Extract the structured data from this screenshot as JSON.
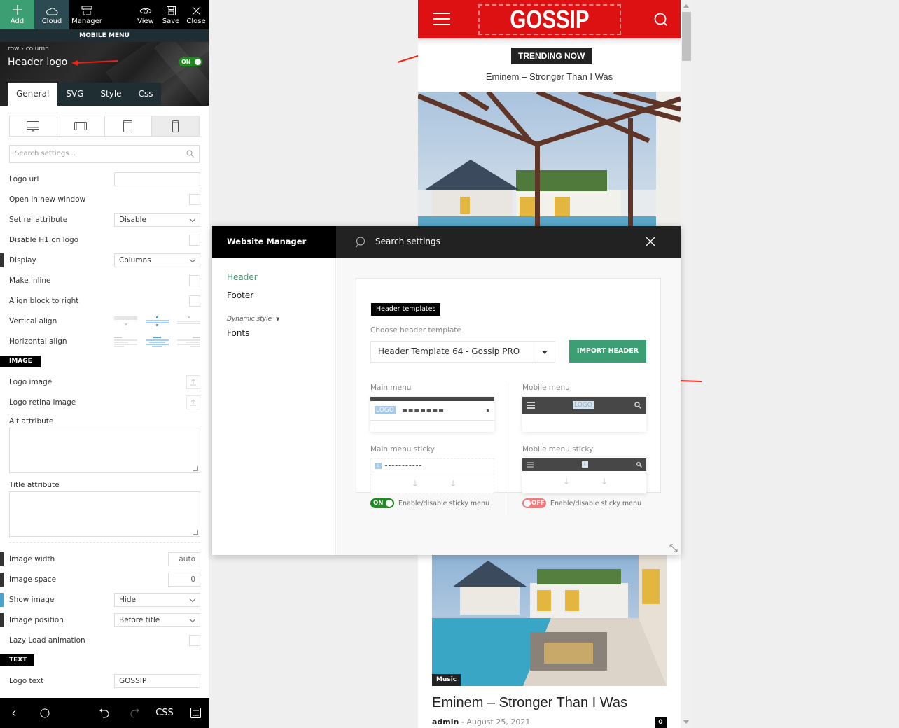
{
  "editor": {
    "toolbar": {
      "add": "Add",
      "cloud": "Cloud",
      "manager": "Manager",
      "view": "View",
      "save": "Save",
      "close": "Close"
    },
    "context_bar": "MOBILE MENU",
    "breadcrumb": [
      "row",
      "column"
    ],
    "element_title": "Header logo",
    "element_toggle": "ON",
    "tabs": [
      "General",
      "SVG",
      "Style",
      "Css"
    ],
    "active_tab": "General",
    "devices": [
      "desktop",
      "tablet-landscape",
      "tablet-portrait",
      "phone"
    ],
    "active_device": "phone",
    "search_placeholder": "Search settings...",
    "settings": {
      "logo_url": {
        "label": "Logo url",
        "value": ""
      },
      "open_new_window": {
        "label": "Open in new window",
        "checked": false
      },
      "rel_attribute": {
        "label": "Set rel attribute",
        "value": "Disable"
      },
      "disable_h1": {
        "label": "Disable H1 on logo",
        "checked": false
      },
      "display": {
        "label": "Display",
        "value": "Columns"
      },
      "make_inline": {
        "label": "Make inline",
        "checked": false
      },
      "align_right": {
        "label": "Align block to right",
        "checked": false
      },
      "vertical_align": {
        "label": "Vertical align",
        "options": [
          "top",
          "center",
          "bottom"
        ],
        "selected": "center"
      },
      "horizontal_align": {
        "label": "Horizontal align",
        "options": [
          "left",
          "center",
          "right"
        ],
        "selected": "center"
      }
    },
    "image_section": {
      "tag": "IMAGE",
      "logo_image": "Logo image",
      "logo_retina_image": "Logo retina image",
      "alt_attribute": {
        "label": "Alt attribute",
        "value": ""
      },
      "title_attribute": {
        "label": "Title attribute",
        "value": ""
      },
      "image_width": {
        "label": "Image width",
        "value": "auto"
      },
      "image_space": {
        "label": "Image space",
        "value": "0"
      },
      "show_image": {
        "label": "Show image",
        "value": "Hide"
      },
      "image_position": {
        "label": "Image position",
        "value": "Before title"
      },
      "lazy_load": {
        "label": "Lazy Load animation",
        "checked": false
      }
    },
    "text_section": {
      "tag": "TEXT",
      "logo_text": {
        "label": "Logo text",
        "value": "GOSSIP"
      }
    },
    "bottom_bar": {
      "css_label": "CSS"
    }
  },
  "preview": {
    "logo": "GOSSIP",
    "trending_label": "TRENDING NOW",
    "trending_title": "Eminem – Stronger Than I Was",
    "post": {
      "category": "Music",
      "title": "Eminem – Stronger Than I Was",
      "author": "admin",
      "separator": "-",
      "date": "August 25, 2021",
      "comments": "0"
    },
    "colors": {
      "header_bg": "#dd1111",
      "accent_green": "#3c9f74"
    }
  },
  "website_manager": {
    "title": "Website Manager",
    "search_placeholder": "Search settings",
    "nav": {
      "header": "Header",
      "footer": "Footer",
      "dynamic_style": "Dynamic style",
      "fonts": "Fonts"
    },
    "active_nav": "Header",
    "card_tag": "Header templates",
    "choose_label": "Choose header template",
    "selected_template": "Header Template 64 - Gossip PRO",
    "import_button": "IMPORT HEADER",
    "previews": {
      "main_menu": "Main menu",
      "mobile_menu": "Mobile menu",
      "main_menu_sticky": "Main menu sticky",
      "mobile_menu_sticky": "Mobile menu sticky",
      "logo_placeholder": "LOGO",
      "logo_short": "L"
    },
    "sticky_main": {
      "state": "ON",
      "label": "Enable/disable sticky menu"
    },
    "sticky_mobile": {
      "state": "OFF",
      "label": "Enable/disable sticky menu"
    }
  }
}
